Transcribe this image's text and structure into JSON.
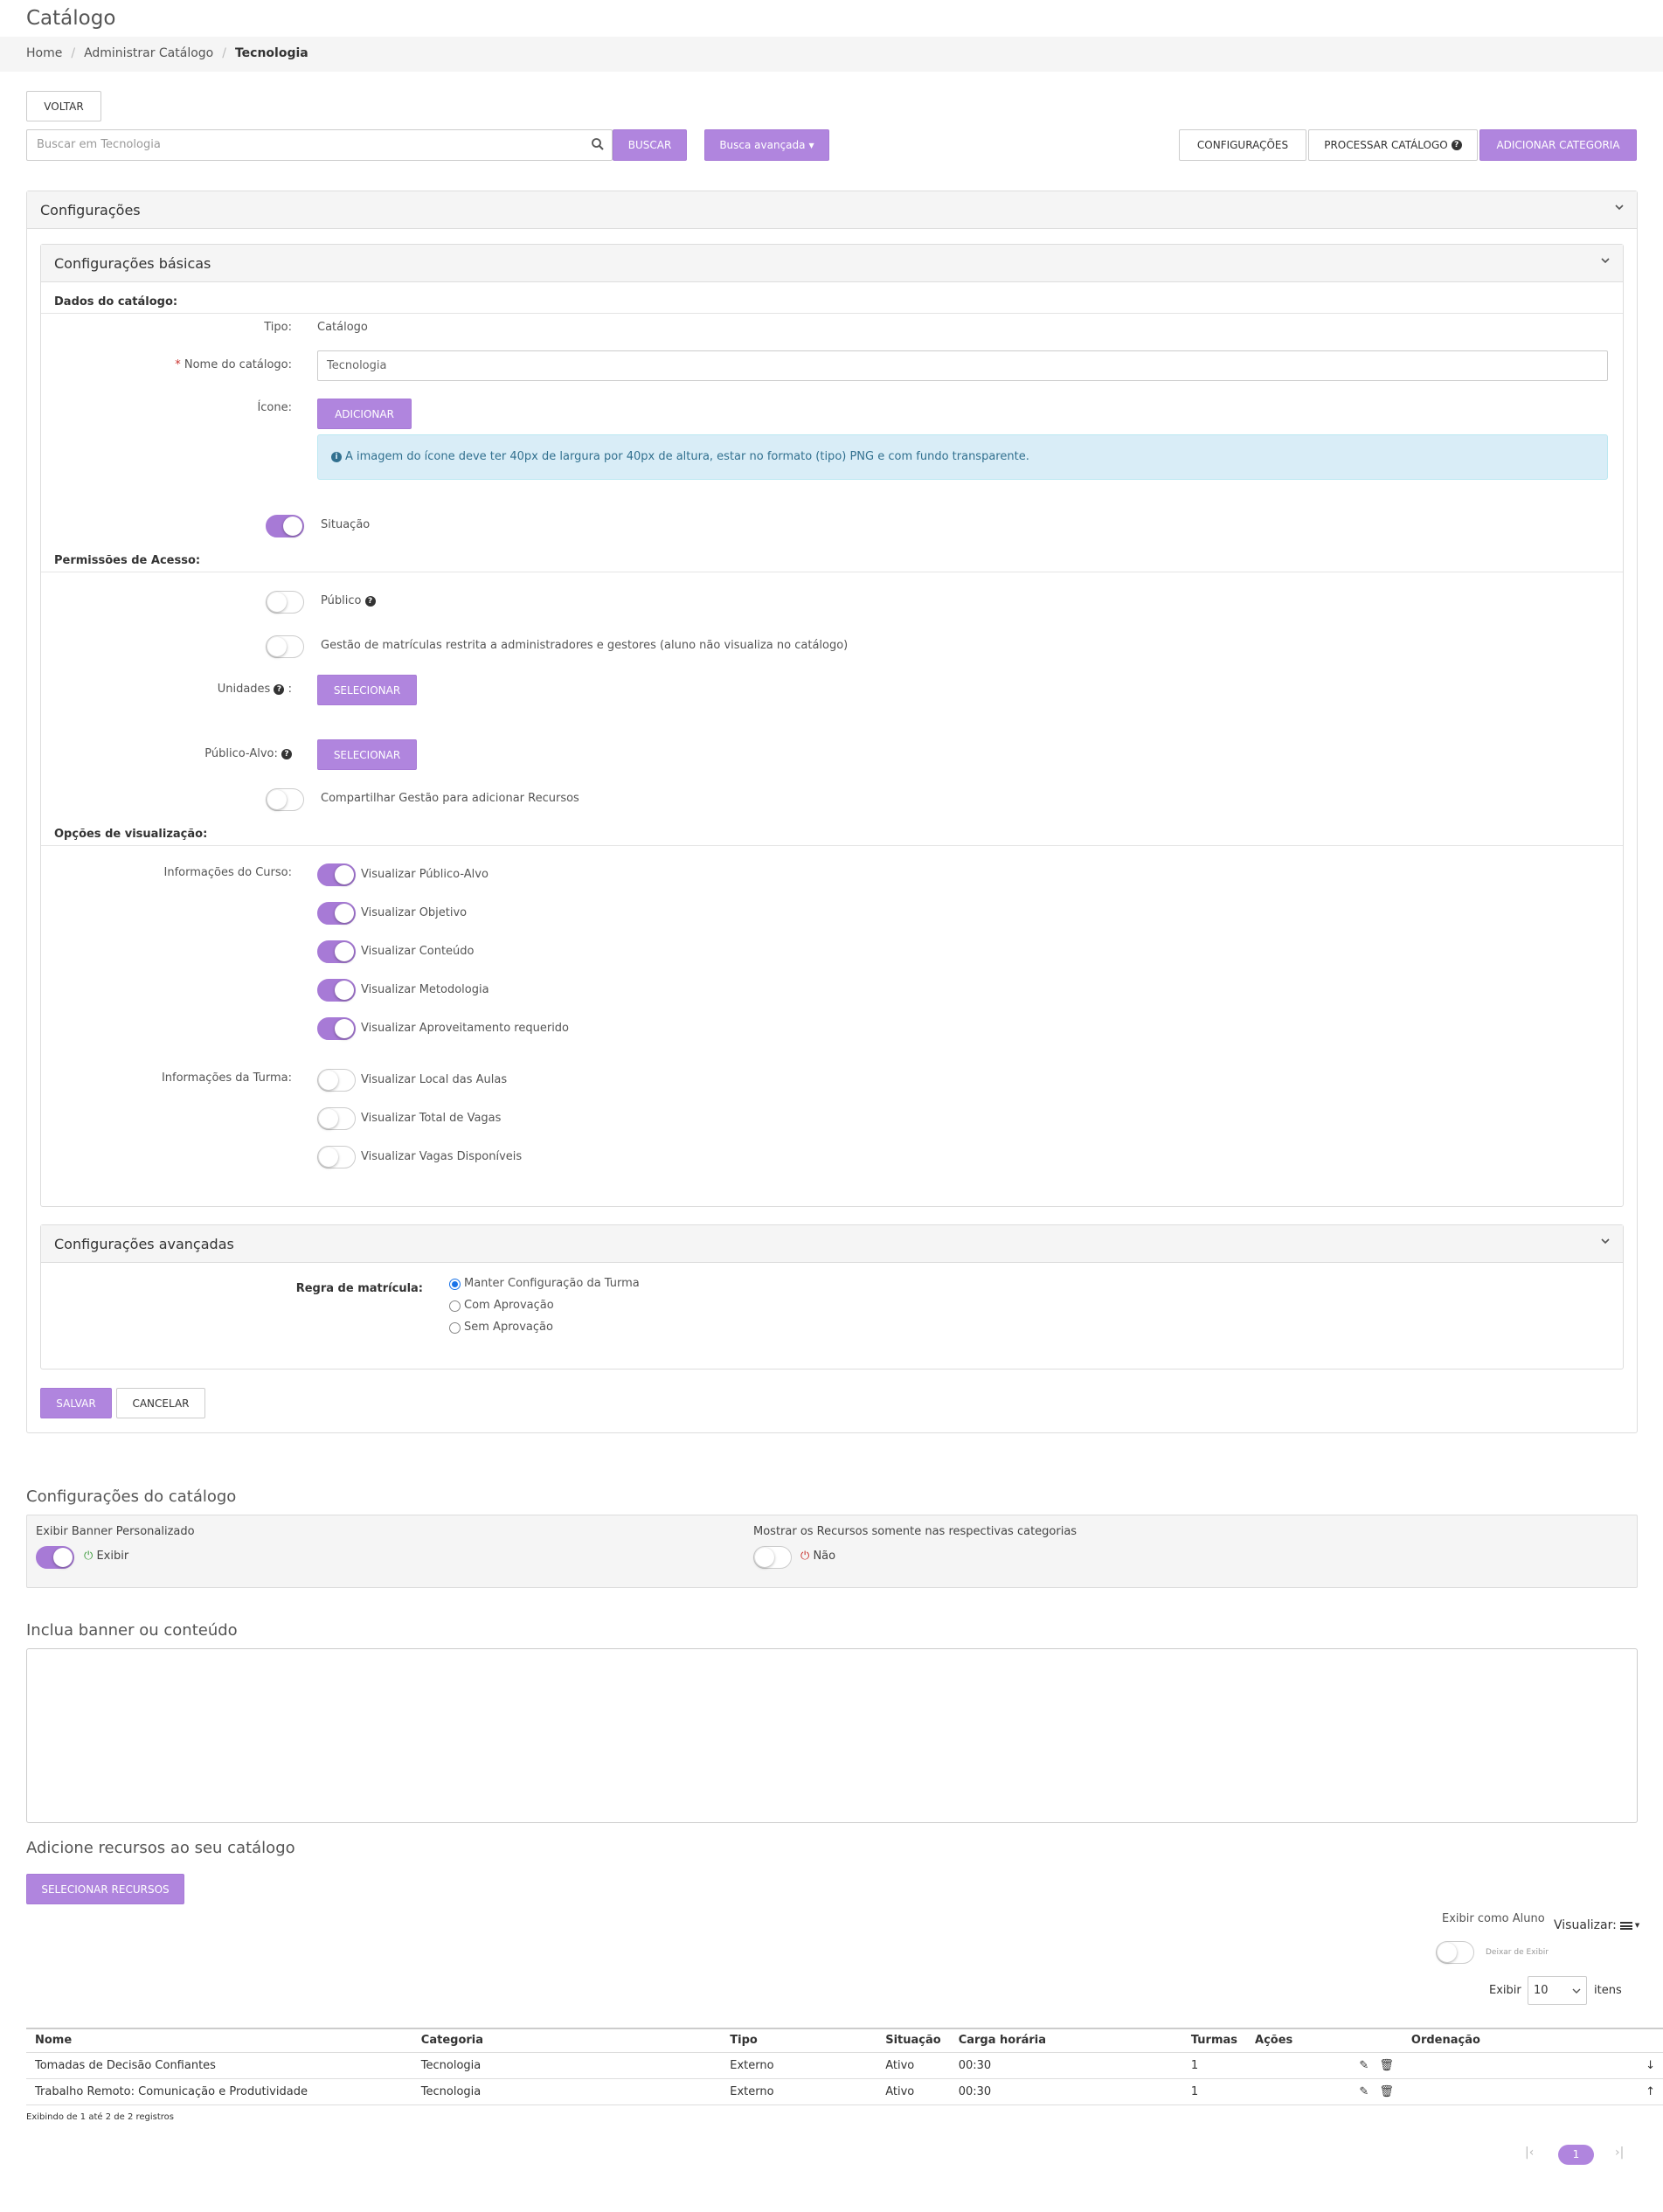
{
  "page_title": "Catálogo",
  "breadcrumb": [
    "Home",
    "Administrar Catálogo",
    "Tecnologia"
  ],
  "toolbar": {
    "back": "VOLTAR",
    "search_placeholder": "Buscar em Tecnologia",
    "search": "BUSCAR",
    "advanced": "Busca avançada",
    "config": "CONFIGURAÇÕES",
    "process": "PROCESSAR CATÁLOGO",
    "add_category": "ADICIONAR CATEGORIA"
  },
  "config_panel": {
    "title": "Configurações",
    "basic": {
      "title": "Configurações básicas",
      "catalog_data": "Dados do catálogo:",
      "type_label": "Tipo:",
      "type_value": "Catálogo",
      "required_mark": "*",
      "name_label": "Nome do catálogo:",
      "name_value": "Tecnologia",
      "icon_label": "Ícone:",
      "icon_add": "ADICIONAR",
      "icon_info": "A imagem do ícone deve ter 40px de largura por 40px de altura, estar no formato (tipo) PNG e com fundo transparente.",
      "status_label": "Situação",
      "status_on": true,
      "permissions": "Permissões de Acesso:",
      "public_label": "Público",
      "public_on": false,
      "restricted_label": "Gestão de matrículas restrita a administradores e gestores (aluno não visualiza no catálogo)",
      "restricted_on": false,
      "units_label": "Unidades",
      "units_colon": ":",
      "units_select": "SELECIONAR",
      "audience_label": "Público-Alvo:",
      "audience_select": "SELECIONAR",
      "share_label": "Compartilhar Gestão para adicionar Recursos",
      "share_on": false,
      "view_options": "Opções de visualização:",
      "course_info_label": "Informações do Curso:",
      "course_items": [
        {
          "label": "Visualizar Público-Alvo",
          "on": true
        },
        {
          "label": "Visualizar Objetivo",
          "on": true
        },
        {
          "label": "Visualizar Conteúdo",
          "on": true
        },
        {
          "label": "Visualizar Metodologia",
          "on": true
        },
        {
          "label": "Visualizar Aproveitamento requerido",
          "on": true
        }
      ],
      "class_info_label": "Informações da Turma:",
      "class_items": [
        {
          "label": "Visualizar Local das Aulas",
          "on": false
        },
        {
          "label": "Visualizar Total de Vagas",
          "on": false
        },
        {
          "label": "Visualizar Vagas Disponíveis",
          "on": false
        }
      ]
    },
    "advanced": {
      "title": "Configurações avançadas",
      "rule_label": "Regra de matrícula:",
      "options": [
        "Manter Configuração da Turma",
        "Com Aprovação",
        "Sem Aprovação"
      ],
      "selected": "Manter Configuração da Turma"
    },
    "save": "SALVAR",
    "cancel": "CANCELAR"
  },
  "catalog_config": {
    "title": "Configurações do catálogo",
    "banner_label": "Exibir Banner Personalizado",
    "banner_state": "Exibir",
    "banner_on": true,
    "resources_label": "Mostrar os Recursos somente nas respectivas categorias",
    "resources_state": "Não",
    "resources_on": false
  },
  "banner_section": {
    "title": "Inclua banner ou conteúdo"
  },
  "resources_section": {
    "title": "Adicione recursos ao seu catálogo",
    "select_button": "SELECIONAR RECURSOS",
    "student_view_label": "Exibir como Aluno",
    "student_view_state": "Deixar de Exibir",
    "visualize_label": "Visualizar:",
    "show_label": "Exibir",
    "show_value": "10",
    "items_label": "itens"
  },
  "table": {
    "columns": [
      "Nome",
      "Categoria",
      "Tipo",
      "Situação",
      "Carga horária",
      "Turmas",
      "Ações",
      "Ordenação"
    ],
    "rows": [
      {
        "nome": "Tomadas de Decisão Confiantes",
        "categoria": "Tecnologia",
        "tipo": "Externo",
        "situacao": "Ativo",
        "carga": "00:30",
        "turmas": "1",
        "order": "down"
      },
      {
        "nome": "Trabalho Remoto: Comunicação e Produtividade",
        "categoria": "Tecnologia",
        "tipo": "Externo",
        "situacao": "Ativo",
        "carga": "00:30",
        "turmas": "1",
        "order": "up"
      }
    ],
    "footer": "Exibindo de 1 até 2 de 2 registros",
    "current_page": "1"
  },
  "colors": {
    "accent": "#b085de",
    "toggle_on": "#a77ad6",
    "info_bg": "#d9edf7",
    "on_icon": "#3c9a3c",
    "off_icon": "#c9302c"
  }
}
